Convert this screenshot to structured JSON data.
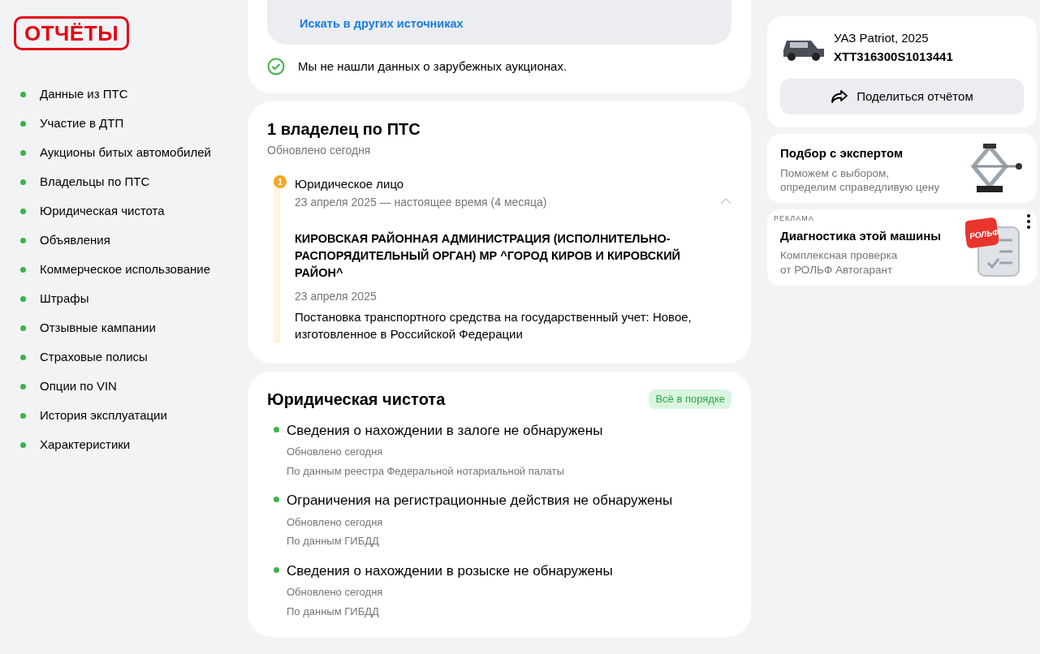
{
  "logo": "ОТЧЁТЫ",
  "sidebar": {
    "items": [
      {
        "label": "Данные из ПТС"
      },
      {
        "label": "Участие в ДТП"
      },
      {
        "label": "Аукционы битых автомобилей"
      },
      {
        "label": "Владельцы по ПТС"
      },
      {
        "label": "Юридическая чистота"
      },
      {
        "label": "Объявления"
      },
      {
        "label": "Коммерческое использование"
      },
      {
        "label": "Штрафы"
      },
      {
        "label": "Отзывные кампании"
      },
      {
        "label": "Страховые полисы"
      },
      {
        "label": "Опции по VIN"
      },
      {
        "label": "История эксплуатации"
      },
      {
        "label": "Характеристики"
      }
    ]
  },
  "auctions": {
    "link": "Искать в других источниках",
    "note": "Мы не нашли данных о зарубежных аукционах."
  },
  "owners": {
    "title": "1 владелец по ПТС",
    "updated": "Обновлено сегодня",
    "entries": [
      {
        "number": "1",
        "type": "Юридическое лицо",
        "period": "23 апреля 2025 — настоящее время (4 месяца)",
        "expanded": true,
        "name": "КИРОВСКАЯ РАЙОННАЯ АДМИНИСТРАЦИЯ (ИСПОЛНИТЕЛЬНО-РАСПОРЯДИТЕЛЬНЫЙ ОРГАН) МР ^ГОРОД КИРОВ И КИРОВСКИЙ РАЙОН^",
        "date": "23 апреля 2025",
        "event": "Постановка транспортного средства на государственный учет: Новое, изготовленное в Российской Федерации"
      }
    ]
  },
  "legal": {
    "title": "Юридическая чистота",
    "status": {
      "kind": "ok",
      "label": "Всё в порядке"
    },
    "checks": [
      {
        "title": "Сведения о нахождении в залоге не обнаружены",
        "updated": "Обновлено сегодня",
        "source": "По данным реестра Федеральной нотариальной палаты"
      },
      {
        "title": "Ограничения на регистрационные действия не обнаружены",
        "updated": "Обновлено сегодня",
        "source": "По данным ГИБДД"
      },
      {
        "title": "Сведения о нахождении в розыске не обнаружены",
        "updated": "Обновлено сегодня",
        "source": "По данным ГИБДД"
      }
    ]
  },
  "car": {
    "model": "УАЗ Patriot, 2025",
    "vin": "XTT316300S1013441",
    "share": "Поделиться отчётом"
  },
  "promos": [
    {
      "title": "Подбор с экспертом",
      "text": "Поможем с выбором,\nопределим справедливую цену",
      "kind": "jack"
    },
    {
      "ad_label": "РЕКЛАМА",
      "title": "Диагностика этой машины",
      "text": "Комплексная проверка\nот РОЛЬФ Автогарант",
      "kind": "checklist",
      "badge": "РОЛЬФ"
    }
  ]
}
